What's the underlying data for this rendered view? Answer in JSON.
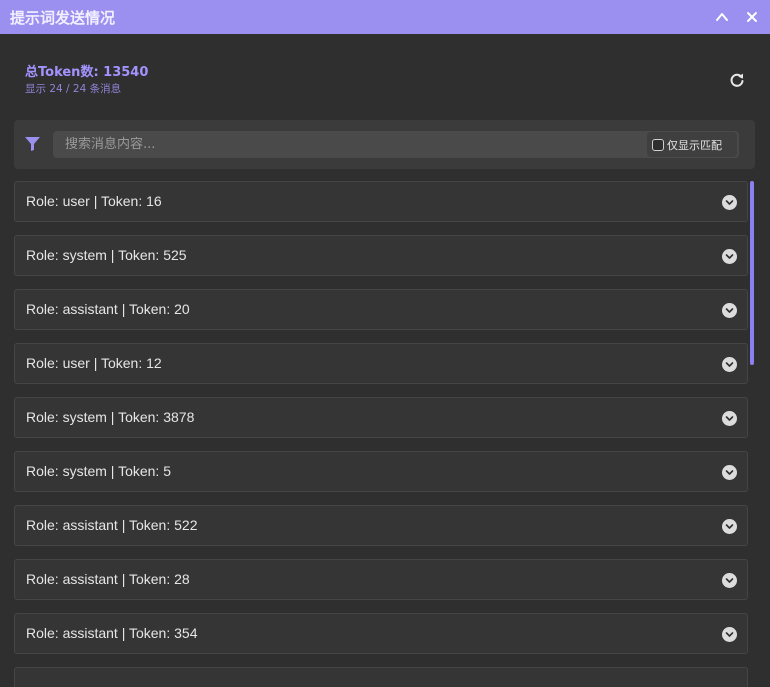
{
  "window": {
    "title": "提示词发送情况"
  },
  "summary": {
    "total_tokens": "总Token数: 13540",
    "message_count": "显示 24 / 24 条消息"
  },
  "filter": {
    "search_placeholder": "搜索消息内容...",
    "search_value": "",
    "match_only_label": "仅显示匹配",
    "match_only_checked": false
  },
  "messages": [
    {
      "label": "Role: user | Token: 16"
    },
    {
      "label": "Role: system | Token: 525"
    },
    {
      "label": "Role: assistant | Token: 20"
    },
    {
      "label": "Role: user | Token: 12"
    },
    {
      "label": "Role: system | Token: 3878"
    },
    {
      "label": "Role: system | Token: 5"
    },
    {
      "label": "Role: assistant | Token: 522"
    },
    {
      "label": "Role: assistant | Token: 28"
    },
    {
      "label": "Role: assistant | Token: 354"
    },
    {
      "label": ""
    }
  ],
  "icons": {
    "collapse": "chevron-up-icon",
    "close": "close-icon",
    "refresh": "refresh-icon",
    "filter": "filter-icon",
    "expand": "chevron-down-circle-icon"
  },
  "colors": {
    "accent": "#9b8ff0",
    "accent_text": "#a393ff",
    "background": "#2f2f2f",
    "row_background": "#353535"
  }
}
